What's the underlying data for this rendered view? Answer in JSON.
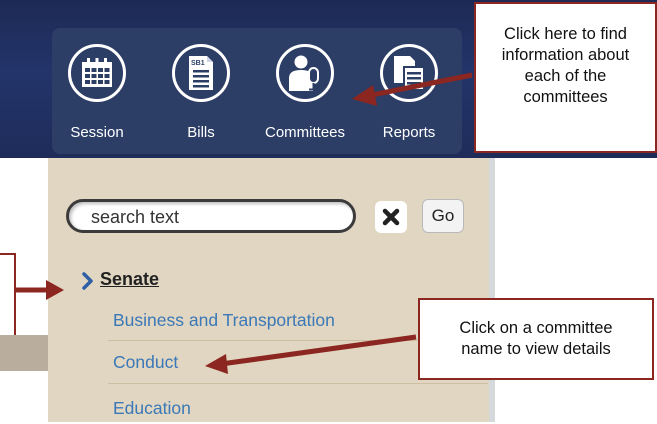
{
  "nav": {
    "items": [
      {
        "label": "Session",
        "icon": "calendar-icon"
      },
      {
        "label": "Bills",
        "icon": "bill-document-icon"
      },
      {
        "label": "Committees",
        "icon": "committee-person-icon"
      },
      {
        "label": "Reports",
        "icon": "report-document-icon"
      }
    ],
    "bill_icon_text": "SB1"
  },
  "search": {
    "placeholder": "search text",
    "value": "",
    "clear_icon": "close-icon",
    "go_label": "Go"
  },
  "committees": {
    "group_label": "Senate",
    "group_icon": "chevron-right-icon",
    "items": [
      {
        "label": "Business and Transportation"
      },
      {
        "label": "Conduct"
      },
      {
        "label": "Education"
      }
    ]
  },
  "callouts": {
    "committees_nav": {
      "lines": [
        "Click here to find",
        "information about",
        "each of the",
        "committees"
      ]
    },
    "committee_name": {
      "lines": [
        "Click on a committee",
        "name to view details"
      ]
    }
  },
  "colors": {
    "header": "#23346a",
    "nav_panel": "#2c3d66",
    "sidebar": "#e0d6c1",
    "link": "#3b78b8",
    "callout_border": "#8b2620",
    "chevron": "#2f5fa5"
  }
}
